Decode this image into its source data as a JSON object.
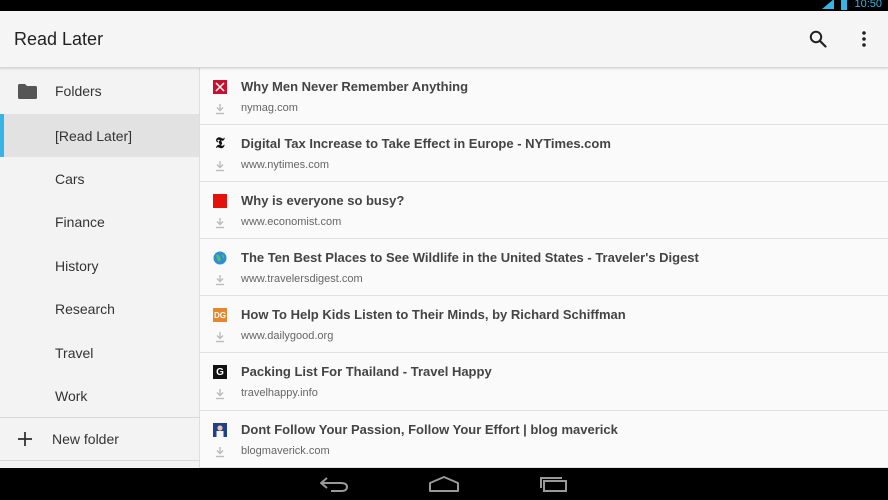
{
  "status": {
    "time": "10:50"
  },
  "app_bar": {
    "title": "Read Later"
  },
  "sidebar": {
    "header": "Folders",
    "items": [
      {
        "label": "[Read Later]",
        "selected": true
      },
      {
        "label": "Cars"
      },
      {
        "label": "Finance"
      },
      {
        "label": "History"
      },
      {
        "label": "Research"
      },
      {
        "label": "Travel"
      },
      {
        "label": "Work"
      }
    ],
    "new_folder": "New folder"
  },
  "articles": [
    {
      "title": "Why Men Never Remember Anything",
      "domain": "nymag.com",
      "favicon": "nymag-icon"
    },
    {
      "title": "Digital Tax Increase to Take Effect in Europe - NYTimes.com",
      "domain": "www.nytimes.com",
      "favicon": "nytimes-icon"
    },
    {
      "title": "Why is everyone so busy?",
      "domain": "www.economist.com",
      "favicon": "economist-icon"
    },
    {
      "title": "The Ten Best Places to See Wildlife in the United States - Traveler's Digest",
      "domain": "www.travelersdigest.com",
      "favicon": "globe-icon"
    },
    {
      "title": "How To Help Kids Listen to Their Minds, by Richard Schiffman",
      "domain": "www.dailygood.org",
      "favicon": "dailygood-icon"
    },
    {
      "title": "Packing List For Thailand - Travel Happy",
      "domain": "travelhappy.info",
      "favicon": "travelhappy-icon"
    },
    {
      "title": "Dont Follow Your Passion, Follow Your Effort | blog maverick",
      "domain": "blogmaverick.com",
      "favicon": "blogmaverick-icon"
    }
  ],
  "colors": {
    "accent": "#33b5e5",
    "economist_red": "#e3120b",
    "dailygood_orange": "#e8862b"
  }
}
